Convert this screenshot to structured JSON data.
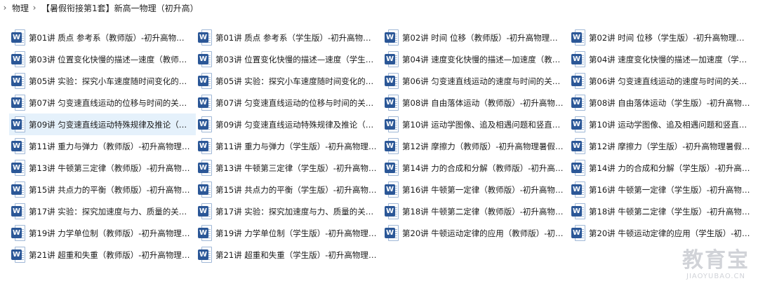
{
  "breadcrumb": {
    "items": [
      "物理",
      "【暑假衔接第1套】新高一物理（初升高）"
    ]
  },
  "icons": {
    "separator": "chevron-right-icon",
    "file": "word-document-icon"
  },
  "colors": {
    "word_blue": "#2b5797",
    "selected_row": "#e5f1fb"
  },
  "files": [
    {
      "name": "第01讲 质点 参考系（教师版）-初升高物理暑...",
      "selected": false
    },
    {
      "name": "第01讲 质点 参考系（学生版）-初升高物理暑...",
      "selected": false
    },
    {
      "name": "第02讲 时间 位移（教师版）-初升高物理暑假...",
      "selected": false
    },
    {
      "name": "第02讲 时间 位移（学生版）-初升高物理暑假...",
      "selected": false
    },
    {
      "name": "第03讲 位置变化快慢的描述—速度（教师版）...",
      "selected": false
    },
    {
      "name": "第03讲 位置变化快慢的描述—速度（学生版）...",
      "selected": false
    },
    {
      "name": "第04讲 速度变化快慢的描述—加速度（教师版...",
      "selected": false
    },
    {
      "name": "第04讲 速度变化快慢的描述—加速度（学生版...",
      "selected": false
    },
    {
      "name": "第05讲 实验：探究小车速度随时间变化的规律...",
      "selected": false
    },
    {
      "name": "第05讲 实验：探究小车速度随时间变化的规律...",
      "selected": false
    },
    {
      "name": "第06讲 匀变速直线运动的速度与时间的关系（...",
      "selected": false
    },
    {
      "name": "第06讲 匀变速直线运动的速度与时间的关系（...",
      "selected": false
    },
    {
      "name": "第07讲 匀变速直线运动的位移与时间的关系（...",
      "selected": false
    },
    {
      "name": "第07讲 匀变速直线运动的位移与时间的关系（...",
      "selected": false
    },
    {
      "name": "第08讲 自由落体运动（教师版）-初升高物理...",
      "selected": false
    },
    {
      "name": "第08讲 自由落体运动（学生版）-初升高物理...",
      "selected": false
    },
    {
      "name": "第09讲 匀变速直线运动特殊规律及推论（教师...",
      "selected": true
    },
    {
      "name": "第09讲 匀变速直线运动特殊规律及推论（学生...",
      "selected": false
    },
    {
      "name": "第10讲 运动学图像、追及相遇问题和竖直上抛...",
      "selected": false
    },
    {
      "name": "第10讲 运动学图像、追及相遇问题和竖直上抛...",
      "selected": false
    },
    {
      "name": "第11讲 重力与弹力（教师版）-初升高物理暑...",
      "selected": false
    },
    {
      "name": "第11讲 重力与弹力（学生版）-初升高物理暑...",
      "selected": false
    },
    {
      "name": "第12讲 摩擦力（教师版）-初升高物理暑假衔...",
      "selected": false
    },
    {
      "name": "第12讲 摩擦力（学生版）-初升高物理暑假衔...",
      "selected": false
    },
    {
      "name": "第13讲 牛顿第三定律（教师版）-初升高物理...",
      "selected": false
    },
    {
      "name": "第13讲 牛顿第三定律（学生版）-初升高物理...",
      "selected": false
    },
    {
      "name": "第14讲 力的合成和分解（教师版）-初升高物...",
      "selected": false
    },
    {
      "name": "第14讲 力的合成和分解（学生版）-初升高物...",
      "selected": false
    },
    {
      "name": "第15讲 共点力的平衡（教师版）-初升高物理...",
      "selected": false
    },
    {
      "name": "第15讲 共点力的平衡（学生版）-初升高物理...",
      "selected": false
    },
    {
      "name": "第16讲 牛顿第一定律（教师版）-初升高物理...",
      "selected": false
    },
    {
      "name": "第16讲 牛顿第一定律（学生版）-初升高物理...",
      "selected": false
    },
    {
      "name": "第17讲 实验：探究加速度与力、质量的关系（...",
      "selected": false
    },
    {
      "name": "第17讲 实验：探究加速度与力、质量的关系（...",
      "selected": false
    },
    {
      "name": "第18讲 牛顿第二定律（教师版）-初升高物理...",
      "selected": false
    },
    {
      "name": "第18讲 牛顿第二定律（学生版）-初升高物理...",
      "selected": false
    },
    {
      "name": "第19讲 力学单位制（教师版）-初升高物理暑...",
      "selected": false
    },
    {
      "name": "第19讲 力学单位制（学生版）-初升高物理暑...",
      "selected": false
    },
    {
      "name": "第20讲 牛顿运动定律的应用（教师版）-初升...",
      "selected": false
    },
    {
      "name": "第20讲 牛顿运动定律的应用（学生版）-初升...",
      "selected": false
    },
    {
      "name": "第21讲 超重和失重（教师版）-初升高物理暑...",
      "selected": false
    },
    {
      "name": "第21讲 超重和失重（学生版）-初升高物理暑...",
      "selected": false
    }
  ],
  "watermark": {
    "main": "教育宝",
    "sub": "JIAOYUBAO.CN"
  }
}
